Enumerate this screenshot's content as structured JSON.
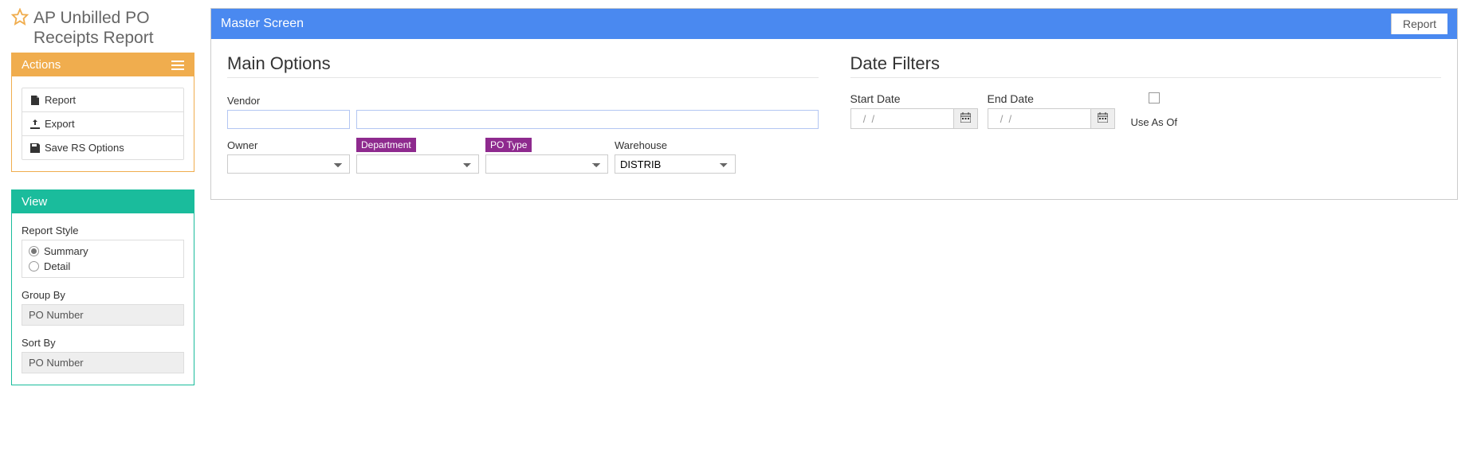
{
  "page": {
    "title": "AP Unbilled PO Receipts Report"
  },
  "actions": {
    "header": "Actions",
    "items": [
      {
        "label": "Report"
      },
      {
        "label": "Export"
      },
      {
        "label": "Save RS Options"
      }
    ]
  },
  "view": {
    "header": "View",
    "report_style_label": "Report Style",
    "style_options": {
      "summary": "Summary",
      "detail": "Detail"
    },
    "group_by_label": "Group By",
    "group_by_value": "PO Number",
    "sort_by_label": "Sort By",
    "sort_by_value": "PO Number"
  },
  "master": {
    "header": "Master Screen",
    "tab": "Report",
    "main_options_title": "Main Options",
    "date_filters_title": "Date Filters",
    "labels": {
      "vendor": "Vendor",
      "owner": "Owner",
      "department": "Department",
      "po_type": "PO Type",
      "warehouse": "Warehouse",
      "start_date": "Start Date",
      "end_date": "End Date",
      "use_as_of": "Use As Of"
    },
    "values": {
      "vendor_code": "",
      "vendor_name": "",
      "owner": "",
      "department": "",
      "po_type": "",
      "warehouse": "DISTRIB",
      "start_date": "  /  /",
      "end_date": "  /  /"
    }
  }
}
